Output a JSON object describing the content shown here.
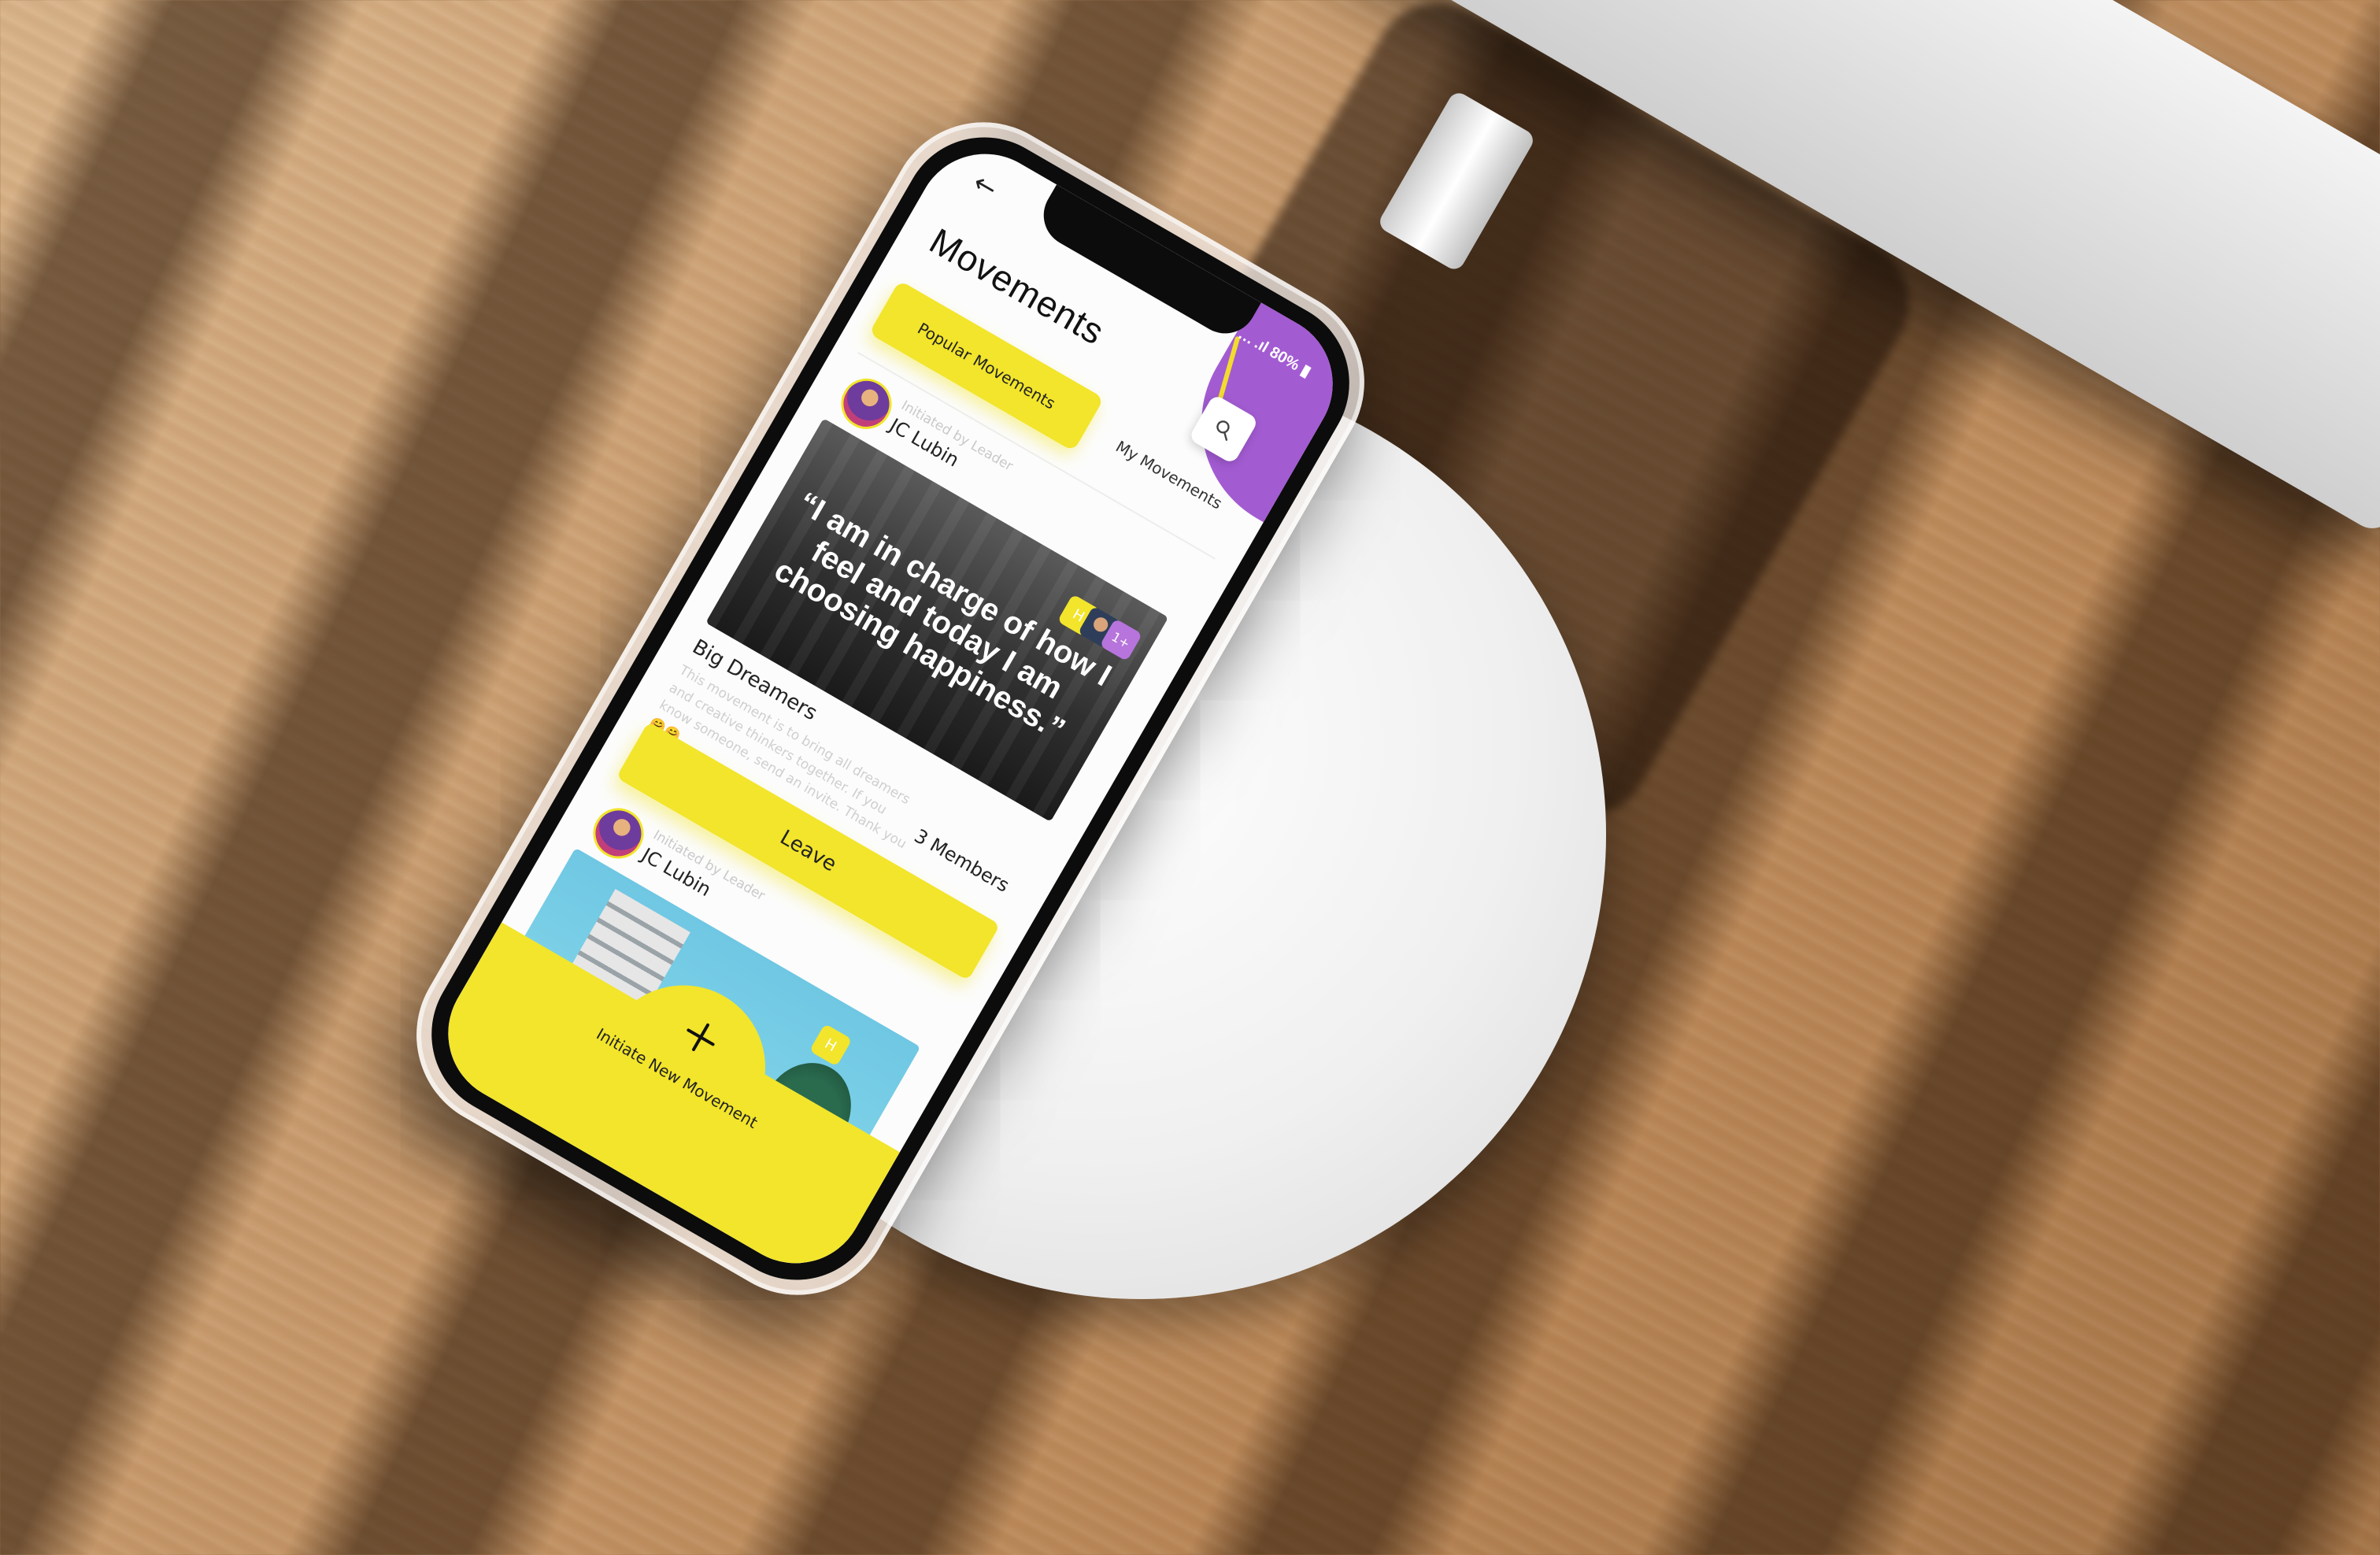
{
  "screen": {
    "title": "Movements",
    "status_text": "… .ıl 80% ▮",
    "back_icon": "arrow-left-icon",
    "search_icon": "search-icon"
  },
  "tabs": {
    "popular": "Popular Movements",
    "mine": "My Movements"
  },
  "cards": [
    {
      "initiated_by": "Initiated by Leader",
      "leader": "JC Lubin",
      "quote": "“I am in charge of how I feel and today I am choosing happiness.”",
      "member_badge_initial": "H",
      "member_badge_more": "1+",
      "movement_name": "Big Dreamers",
      "description": "This movement is to bring all dreamers and creative thinkers together. If you know someone, send an invite. Thank you 🤗🤗",
      "members": "3 Members",
      "action": "Leave"
    },
    {
      "initiated_by": "Initiated by Leader",
      "leader": "JC Lubin",
      "member_badge_initial": "H"
    }
  ],
  "bottom": {
    "label": "Initiate New Movement",
    "icon": "plus-icon"
  },
  "colors": {
    "accent_yellow": "#f2e52b",
    "accent_purple": "#a35bd2"
  }
}
